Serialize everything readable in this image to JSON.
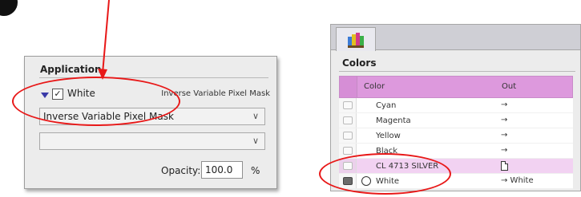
{
  "application_panel": {
    "title": "Application",
    "channel_label": "White",
    "channel_checked": true,
    "mode_label": "Inverse Variable Pixel Mask",
    "dropdown1_value": "Inverse Variable Pixel Mask",
    "dropdown2_value": "",
    "opacity_label": "Opacity:",
    "opacity_value": "100.0",
    "opacity_unit": "%"
  },
  "colors_panel": {
    "title": "Colors",
    "columns": {
      "color": "Color",
      "out": "Out"
    },
    "rows": [
      {
        "name": "Cyan",
        "out": "→"
      },
      {
        "name": "Magenta",
        "out": "→"
      },
      {
        "name": "Yellow",
        "out": "→"
      },
      {
        "name": "Black",
        "out": "→"
      },
      {
        "name": "CL 4713 SILVER",
        "out": ""
      },
      {
        "name": "White",
        "out": "→  White"
      }
    ]
  },
  "icons": {
    "marker": "black-circle-marker",
    "tab": "color-swatches-icon",
    "row_printer": "printer-icon",
    "expand": "triangle-expand-icon"
  },
  "colors": {
    "annotation": "#e81818",
    "header_band": "#dd99dd",
    "highlight_row": "#f2d2f2"
  }
}
